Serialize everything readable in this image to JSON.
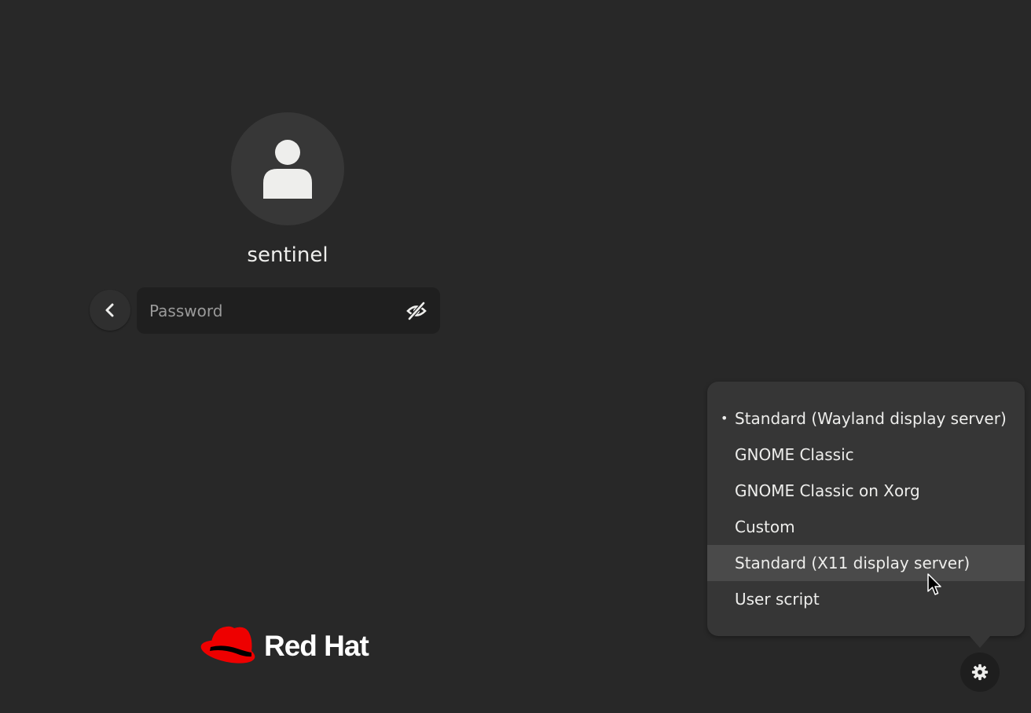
{
  "user": {
    "name": "sentinel",
    "avatar_icon": "user-icon"
  },
  "login": {
    "back_icon": "chevron-left-icon",
    "password_placeholder": "Password",
    "reveal_icon": "eye-slash-icon"
  },
  "session_menu": {
    "selected_index": 0,
    "hovered_index": 4,
    "selected_marker": "•",
    "items": [
      {
        "label": "Standard (Wayland display server)"
      },
      {
        "label": "GNOME Classic"
      },
      {
        "label": "GNOME Classic on Xorg"
      },
      {
        "label": "Custom"
      },
      {
        "label": "Standard (X11 display server)"
      },
      {
        "label": "User script"
      }
    ]
  },
  "settings": {
    "icon": "gear-icon"
  },
  "branding": {
    "logo_text": "Red Hat",
    "logo_icon": "red-hat-fedora-icon",
    "brand_color": "#ee0000"
  },
  "colors": {
    "background": "#282828",
    "menu_background": "#363636",
    "menu_hover": "#4a4a4a",
    "field_background": "#1f1f1f"
  }
}
